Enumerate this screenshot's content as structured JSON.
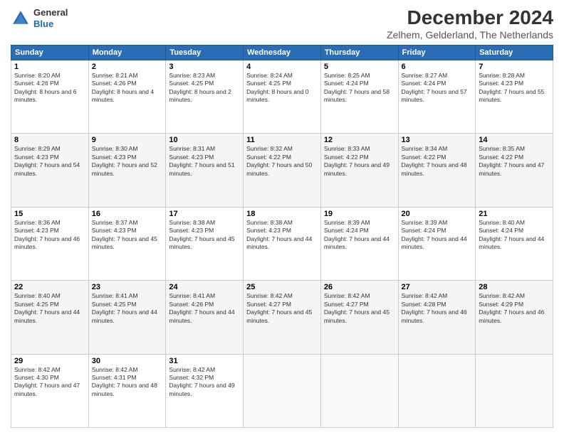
{
  "header": {
    "logo": {
      "general": "General",
      "blue": "Blue"
    },
    "title": "December 2024",
    "location": "Zelhem, Gelderland, The Netherlands"
  },
  "days_of_week": [
    "Sunday",
    "Monday",
    "Tuesday",
    "Wednesday",
    "Thursday",
    "Friday",
    "Saturday"
  ],
  "weeks": [
    [
      {
        "day": "1",
        "sunrise": "8:20 AM",
        "sunset": "4:26 PM",
        "daylight": "8 hours and 6 minutes."
      },
      {
        "day": "2",
        "sunrise": "8:21 AM",
        "sunset": "4:26 PM",
        "daylight": "8 hours and 4 minutes."
      },
      {
        "day": "3",
        "sunrise": "8:23 AM",
        "sunset": "4:25 PM",
        "daylight": "8 hours and 2 minutes."
      },
      {
        "day": "4",
        "sunrise": "8:24 AM",
        "sunset": "4:25 PM",
        "daylight": "8 hours and 0 minutes."
      },
      {
        "day": "5",
        "sunrise": "8:25 AM",
        "sunset": "4:24 PM",
        "daylight": "7 hours and 58 minutes."
      },
      {
        "day": "6",
        "sunrise": "8:27 AM",
        "sunset": "4:24 PM",
        "daylight": "7 hours and 57 minutes."
      },
      {
        "day": "7",
        "sunrise": "8:28 AM",
        "sunset": "4:23 PM",
        "daylight": "7 hours and 55 minutes."
      }
    ],
    [
      {
        "day": "8",
        "sunrise": "8:29 AM",
        "sunset": "4:23 PM",
        "daylight": "7 hours and 54 minutes."
      },
      {
        "day": "9",
        "sunrise": "8:30 AM",
        "sunset": "4:23 PM",
        "daylight": "7 hours and 52 minutes."
      },
      {
        "day": "10",
        "sunrise": "8:31 AM",
        "sunset": "4:23 PM",
        "daylight": "7 hours and 51 minutes."
      },
      {
        "day": "11",
        "sunrise": "8:32 AM",
        "sunset": "4:22 PM",
        "daylight": "7 hours and 50 minutes."
      },
      {
        "day": "12",
        "sunrise": "8:33 AM",
        "sunset": "4:22 PM",
        "daylight": "7 hours and 49 minutes."
      },
      {
        "day": "13",
        "sunrise": "8:34 AM",
        "sunset": "4:22 PM",
        "daylight": "7 hours and 48 minutes."
      },
      {
        "day": "14",
        "sunrise": "8:35 AM",
        "sunset": "4:22 PM",
        "daylight": "7 hours and 47 minutes."
      }
    ],
    [
      {
        "day": "15",
        "sunrise": "8:36 AM",
        "sunset": "4:23 PM",
        "daylight": "7 hours and 46 minutes."
      },
      {
        "day": "16",
        "sunrise": "8:37 AM",
        "sunset": "4:23 PM",
        "daylight": "7 hours and 45 minutes."
      },
      {
        "day": "17",
        "sunrise": "8:38 AM",
        "sunset": "4:23 PM",
        "daylight": "7 hours and 45 minutes."
      },
      {
        "day": "18",
        "sunrise": "8:38 AM",
        "sunset": "4:23 PM",
        "daylight": "7 hours and 44 minutes."
      },
      {
        "day": "19",
        "sunrise": "8:39 AM",
        "sunset": "4:24 PM",
        "daylight": "7 hours and 44 minutes."
      },
      {
        "day": "20",
        "sunrise": "8:39 AM",
        "sunset": "4:24 PM",
        "daylight": "7 hours and 44 minutes."
      },
      {
        "day": "21",
        "sunrise": "8:40 AM",
        "sunset": "4:24 PM",
        "daylight": "7 hours and 44 minutes."
      }
    ],
    [
      {
        "day": "22",
        "sunrise": "8:40 AM",
        "sunset": "4:25 PM",
        "daylight": "7 hours and 44 minutes."
      },
      {
        "day": "23",
        "sunrise": "8:41 AM",
        "sunset": "4:25 PM",
        "daylight": "7 hours and 44 minutes."
      },
      {
        "day": "24",
        "sunrise": "8:41 AM",
        "sunset": "4:26 PM",
        "daylight": "7 hours and 44 minutes."
      },
      {
        "day": "25",
        "sunrise": "8:42 AM",
        "sunset": "4:27 PM",
        "daylight": "7 hours and 45 minutes."
      },
      {
        "day": "26",
        "sunrise": "8:42 AM",
        "sunset": "4:27 PM",
        "daylight": "7 hours and 45 minutes."
      },
      {
        "day": "27",
        "sunrise": "8:42 AM",
        "sunset": "4:28 PM",
        "daylight": "7 hours and 46 minutes."
      },
      {
        "day": "28",
        "sunrise": "8:42 AM",
        "sunset": "4:29 PM",
        "daylight": "7 hours and 46 minutes."
      }
    ],
    [
      {
        "day": "29",
        "sunrise": "8:42 AM",
        "sunset": "4:30 PM",
        "daylight": "7 hours and 47 minutes."
      },
      {
        "day": "30",
        "sunrise": "8:42 AM",
        "sunset": "4:31 PM",
        "daylight": "7 hours and 48 minutes."
      },
      {
        "day": "31",
        "sunrise": "8:42 AM",
        "sunset": "4:32 PM",
        "daylight": "7 hours and 49 minutes."
      },
      null,
      null,
      null,
      null
    ]
  ],
  "labels": {
    "sunrise": "Sunrise:",
    "sunset": "Sunset:",
    "daylight": "Daylight:"
  }
}
